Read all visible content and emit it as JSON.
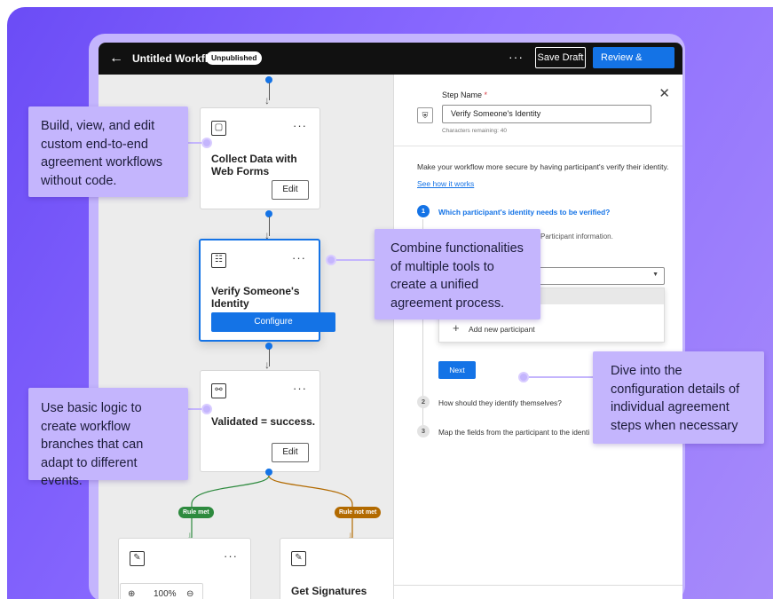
{
  "topbar": {
    "back_icon": "arrow-left-icon",
    "title": "Untitled Workflow",
    "status_badge": "Unpublished",
    "more": "···",
    "save_draft": "Save Draft",
    "publish": "Review & Publish",
    "publish_icon": "caret-right-icon"
  },
  "canvas": {
    "cards": [
      {
        "icon": "clipboard-icon",
        "title": "Collect Data with Web Forms",
        "action": "Edit"
      },
      {
        "icon": "id-card-icon",
        "title": "Verify Someone's Identity",
        "action": "Configure"
      },
      {
        "icon": "branch-icon",
        "title": "Validated = success.",
        "action": "Edit"
      },
      {
        "icon": "pen-icon",
        "title": "",
        "action": ""
      },
      {
        "icon": "pen-icon",
        "title": "Get Signatures",
        "action": ""
      }
    ],
    "more_label": "···",
    "branches": {
      "left": "Rule met",
      "right": "Rule not met"
    },
    "zoom": {
      "in_icon": "zoom-in-icon",
      "value": "100%",
      "out_icon": "zoom-out-icon"
    }
  },
  "panel": {
    "step_name_label": "Step Name",
    "required_mark": "*",
    "close_icon": "close-icon",
    "shield_icon": "shield-icon",
    "step_name_value": "Verify Someone's Identity",
    "chars_remaining": "Characters remaining: 40",
    "intro": "Make your workflow more secure by having participant's verify their identity.",
    "link": "See how it works",
    "steps": [
      {
        "num": "1",
        "text": "Which participant's identity needs to be verified?"
      },
      {
        "num": "2",
        "text": "How should they identify themselves?"
      },
      {
        "num": "3",
        "text": "Map the fields from the participant to the identi"
      }
    ],
    "participant_info_fragment": "Participant information.",
    "add_participant": "Add new participant",
    "next": "Next"
  },
  "callouts": {
    "build": "Build, view, and edit custom end-to-end agreement workflows without code.",
    "combine": "Combine functionalities of multiple tools to create a unified agreement process.",
    "logic": "Use basic logic to create workflow branches that can adapt to different events.",
    "dive": "Dive into the configuration details of individual agreement steps when necessary"
  },
  "colors": {
    "accent": "#1473e6",
    "rule_met": "#2d8a3e",
    "rule_not_met": "#b26a00",
    "callout": "#c4b5fd"
  }
}
